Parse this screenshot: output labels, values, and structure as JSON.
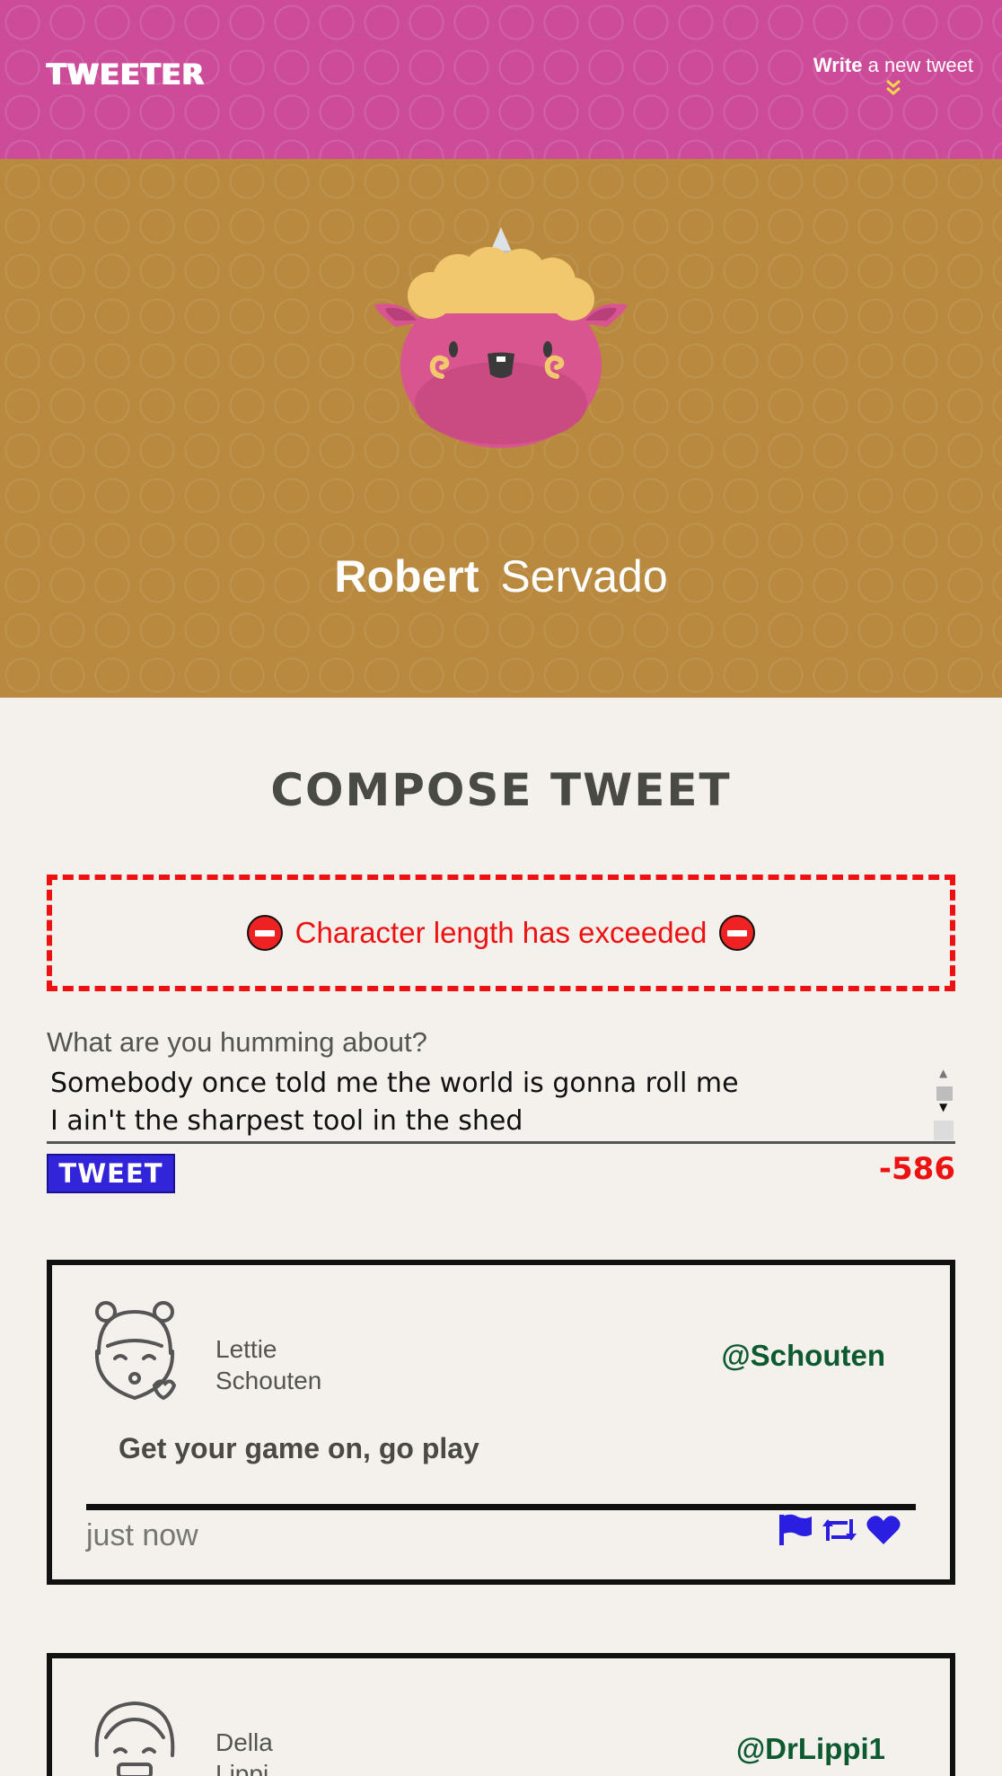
{
  "nav": {
    "brand": "TWEETER",
    "write_bold": "Write",
    "write_rest": "a new tweet",
    "chevron": "»"
  },
  "profile": {
    "first_name": "Robert",
    "last_name": "Servado"
  },
  "compose": {
    "title": "COMPOSE TWEET",
    "error": "Character length has exceeded",
    "label": "What are you humming about?",
    "input_value": "Somebody once told me the world is gonna roll me\nI ain't the sharpest tool in the shed",
    "button_label": "TWEET",
    "counter": "-586"
  },
  "tweets": [
    {
      "first_name": "Lettie",
      "last_name": "Schouten",
      "handle": "@Schouten",
      "content": "Get your game on, go play",
      "time": "just now"
    },
    {
      "first_name": "Della",
      "last_name": "Lippi",
      "handle": "@DrLippi1"
    }
  ],
  "colors": {
    "nav_bg": "#cc4c9a",
    "profile_bg": "#b8893e",
    "error": "#ee1111",
    "button": "#3224d8",
    "handle": "#0d5a30",
    "action_icons": "#2a1fe0"
  },
  "icons": {
    "error": "no-entry-icon",
    "flag": "flag-icon",
    "retweet": "retweet-icon",
    "like": "heart-icon"
  }
}
